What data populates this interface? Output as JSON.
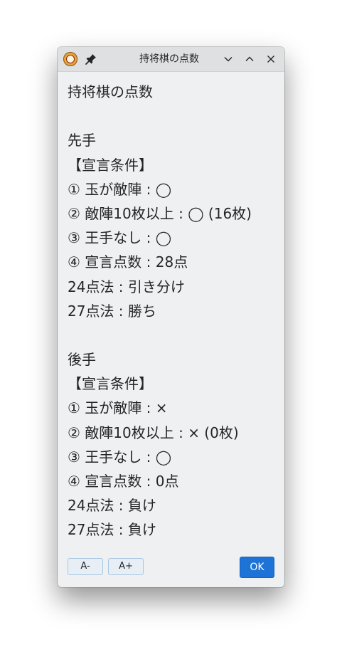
{
  "window": {
    "title": "持将棋の点数"
  },
  "lines": [
    "持将棋の点数",
    "",
    "先手",
    "【宣言条件】",
    "① 玉が敵陣 : ◯",
    "② 敵陣10枚以上 : ◯ (16枚)",
    "③ 王手なし : ◯",
    "④ 宣言点数 : 28点",
    "24点法 : 引き分け",
    "27点法 : 勝ち",
    "",
    "後手",
    "【宣言条件】",
    "① 玉が敵陣 : ×",
    "② 敵陣10枚以上 : × (0枚)",
    "③ 王手なし : ◯",
    "④ 宣言点数 : 0点",
    "24点法 : 負け",
    "27点法 : 負け"
  ],
  "buttons": {
    "font_smaller": "A-",
    "font_larger": "A+",
    "ok": "OK"
  },
  "icons": {
    "app": "shogi-piece-icon",
    "pin": "pin-icon",
    "minimize": "chevron-down-icon",
    "maximize": "chevron-up-icon",
    "close": "close-icon"
  },
  "colors": {
    "ok_button": "#1e73d6",
    "window_bg": "#eff0f1",
    "titlebar_bg": "#dee0e2"
  }
}
